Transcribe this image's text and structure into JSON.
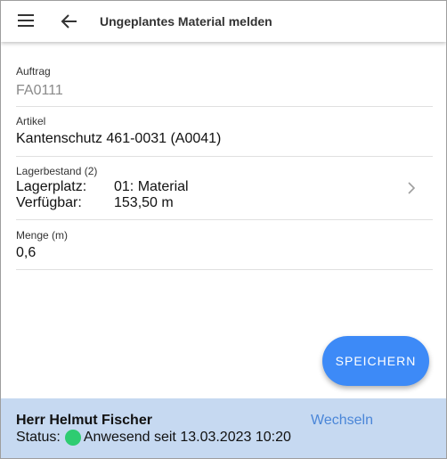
{
  "appbar": {
    "title": "Ungeplantes Material melden",
    "menu_icon": "hamburger-menu-icon",
    "back_icon": "arrow-back-icon"
  },
  "fields": {
    "auftrag": {
      "label": "Auftrag",
      "value": "FA0111"
    },
    "artikel": {
      "label": "Artikel",
      "value": "Kantenschutz 461-0031 (A0041)"
    },
    "lagerbestand": {
      "label": "Lagerbestand (2)",
      "rows": [
        {
          "key": "Lagerplatz:",
          "value": "01: Material"
        },
        {
          "key": "Verfügbar:",
          "value": "153,50 m"
        }
      ],
      "chevron_icon": "chevron-right-icon"
    },
    "menge": {
      "label": "Menge (m)",
      "value": "0,6"
    }
  },
  "actions": {
    "save_label": "SPEICHERN"
  },
  "footer": {
    "user_name": "Herr Helmut Fischer",
    "switch_label": "Wechseln",
    "status_label": "Status:",
    "status_text": "Anwesend seit 13.03.2023 10:20",
    "status_color": "#2ecc71"
  }
}
